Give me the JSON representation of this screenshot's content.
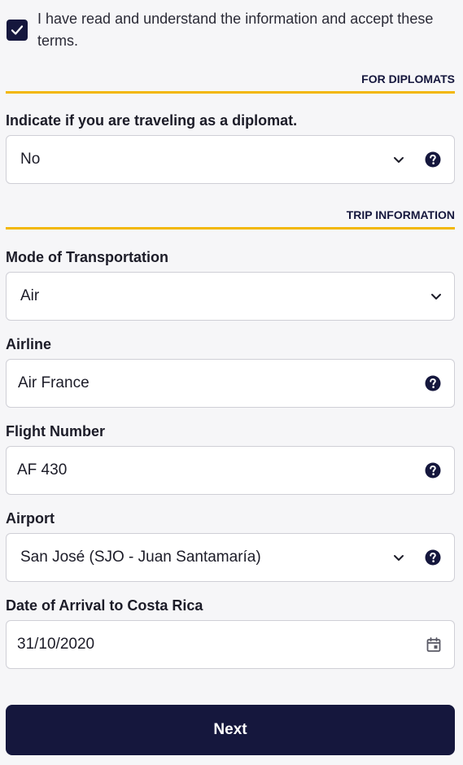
{
  "terms": {
    "checked": true,
    "text": "I have read and understand the information and accept these terms."
  },
  "sections": {
    "diplomats": "FOR DIPLOMATS",
    "trip": "TRIP INFORMATION"
  },
  "fields": {
    "diplomat": {
      "label": "Indicate if you are traveling as a diplomat.",
      "value": "No"
    },
    "transport": {
      "label": "Mode of Transportation",
      "value": "Air"
    },
    "airline": {
      "label": "Airline",
      "value": "Air France"
    },
    "flight": {
      "label": "Flight Number",
      "value": "AF 430"
    },
    "airport": {
      "label": "Airport",
      "value": "San José (SJO - Juan Santamaría)"
    },
    "arrival": {
      "label": "Date of Arrival to Costa Rica",
      "value": "31/10/2020"
    }
  },
  "buttons": {
    "next": "Next"
  },
  "icons": {
    "checkbox": "check-icon",
    "help": "question-circle-icon",
    "dropdown": "chevron-down-icon",
    "calendar": "calendar-icon"
  },
  "colors": {
    "primary": "#15173d",
    "accent": "#f2b705",
    "background": "#f6f6f8"
  }
}
